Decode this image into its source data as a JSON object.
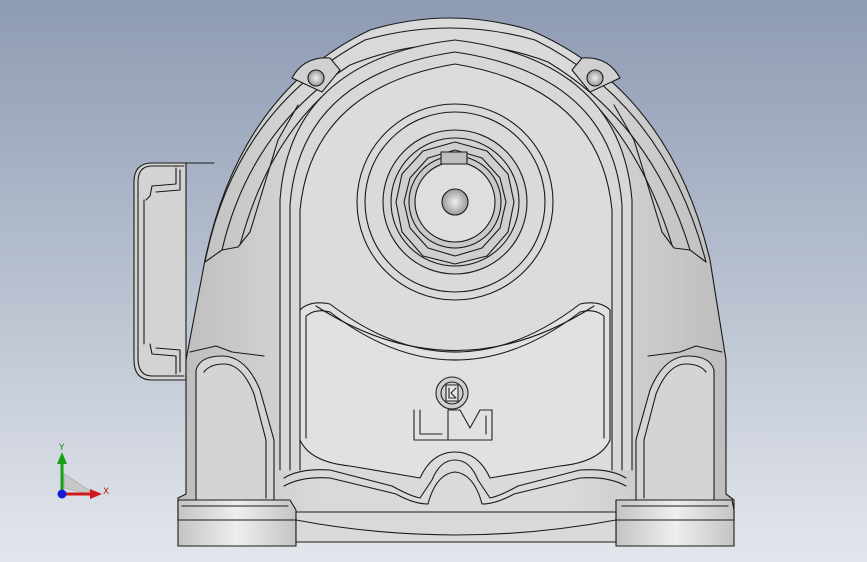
{
  "viewport": {
    "background_top": "#8d9bb3",
    "background_bottom": "#e3e6ec",
    "model_fill": "#d6d6d6",
    "edge_color": "#1a1a1a"
  },
  "model": {
    "name": "gear-reducer-housing",
    "logo_lettering": "LK / LM"
  },
  "triad": {
    "x_label": "X",
    "y_label": "Y",
    "x_color": "#d11919",
    "y_color": "#19a019",
    "z_color": "#1a1ad8"
  }
}
